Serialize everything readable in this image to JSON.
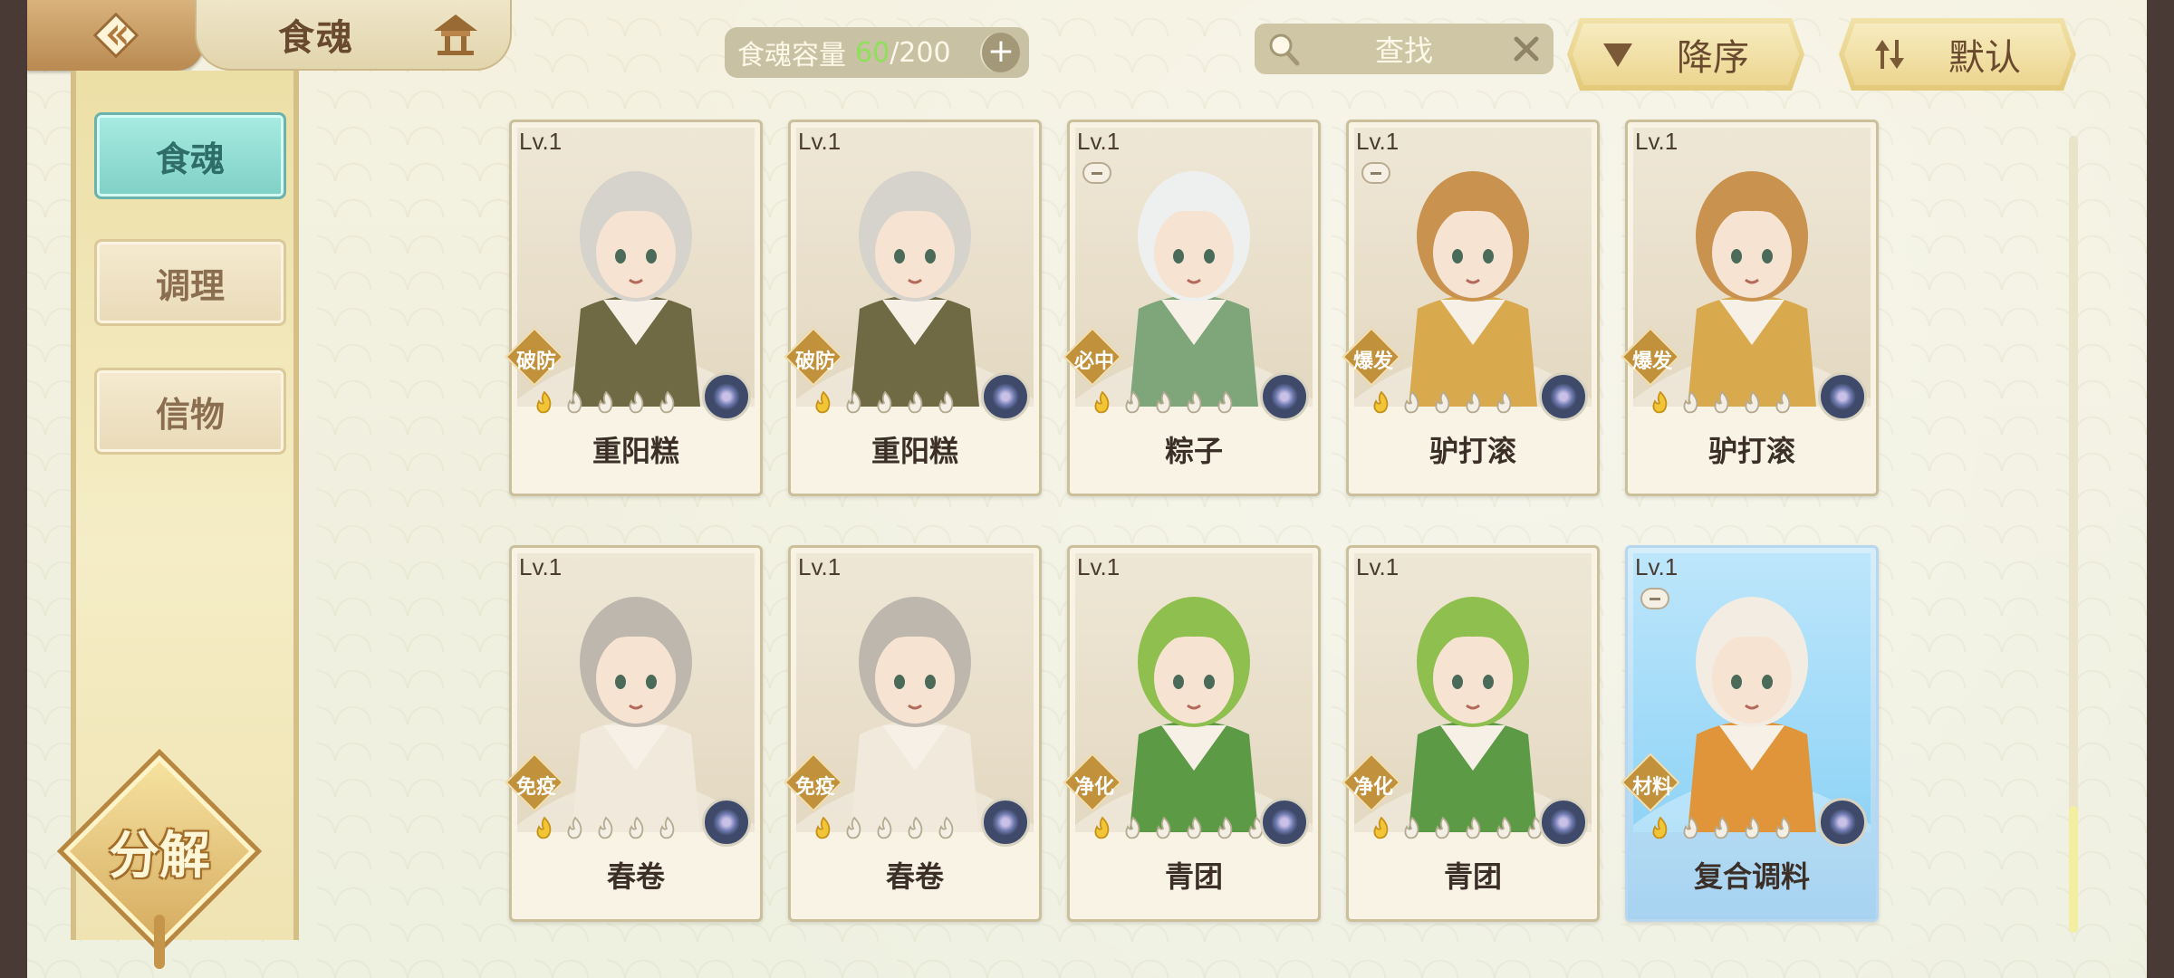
{
  "header": {
    "title": "食魂",
    "capacity_label": "食魂容量",
    "capacity_current": "60",
    "capacity_max": "/200",
    "capacity_add": "+",
    "search_placeholder": "查找",
    "sort_order": "降序",
    "sort_mode": "默认"
  },
  "sidebar": {
    "tabs": [
      {
        "label": "食魂",
        "active": true
      },
      {
        "label": "调理",
        "active": false
      },
      {
        "label": "信物",
        "active": false
      }
    ],
    "decompose_label": "分解"
  },
  "cards": [
    {
      "level": "Lv.1",
      "role": "破防",
      "name": "重阳糕",
      "stars_filled": 1,
      "stars_total": 5,
      "element": "purple-flower-icon",
      "hair": "#d6d2cc",
      "outfit": "#6f6a43"
    },
    {
      "level": "Lv.1",
      "role": "破防",
      "name": "重阳糕",
      "stars_filled": 1,
      "stars_total": 5,
      "element": "purple-flower-icon",
      "hair": "#d6d2cc",
      "outfit": "#6f6a43"
    },
    {
      "level": "Lv.1",
      "role": "必中",
      "name": "粽子",
      "stars_filled": 1,
      "stars_total": 5,
      "element": "purple-flower-icon",
      "hair": "#eef0ef",
      "outfit": "#7fa57a",
      "dim_icon": true
    },
    {
      "level": "Lv.1",
      "role": "爆发",
      "name": "驴打滚",
      "stars_filled": 1,
      "stars_total": 5,
      "element": "purple-flower-icon",
      "hair": "#c9924f",
      "outfit": "#d9a94d",
      "dim_icon": true
    },
    {
      "level": "Lv.1",
      "role": "爆发",
      "name": "驴打滚",
      "stars_filled": 1,
      "stars_total": 5,
      "element": "purple-flower-icon",
      "hair": "#c9924f",
      "outfit": "#d9a94d"
    },
    {
      "level": "Lv.1",
      "role": "免疫",
      "name": "春卷",
      "stars_filled": 1,
      "stars_total": 5,
      "element": "purple-flower-icon",
      "hair": "#bdb7ad",
      "outfit": "#f0e9dc"
    },
    {
      "level": "Lv.1",
      "role": "免疫",
      "name": "春卷",
      "stars_filled": 1,
      "stars_total": 5,
      "element": "purple-flower-icon",
      "hair": "#bdb7ad",
      "outfit": "#f0e9dc"
    },
    {
      "level": "Lv.1",
      "role": "净化",
      "name": "青团",
      "stars_filled": 1,
      "stars_total": 6,
      "element": "purple-flower-icon",
      "hair": "#8fbf4e",
      "outfit": "#5d9a45"
    },
    {
      "level": "Lv.1",
      "role": "净化",
      "name": "青团",
      "stars_filled": 1,
      "stars_total": 6,
      "element": "purple-flower-icon",
      "hair": "#8fbf4e",
      "outfit": "#5d9a45"
    },
    {
      "level": "Lv.1",
      "role": "材料",
      "name": "复合调料",
      "stars_filled": 1,
      "stars_total": 5,
      "element": "purple-flower-icon",
      "hair": "#f2ece2",
      "outfit": "#e0953b",
      "special": true,
      "dim_icon": true
    }
  ],
  "colors": {
    "accent_teal": "#7fd0c6",
    "gold": "#c1913c",
    "capacity_green": "#8ee05a"
  }
}
